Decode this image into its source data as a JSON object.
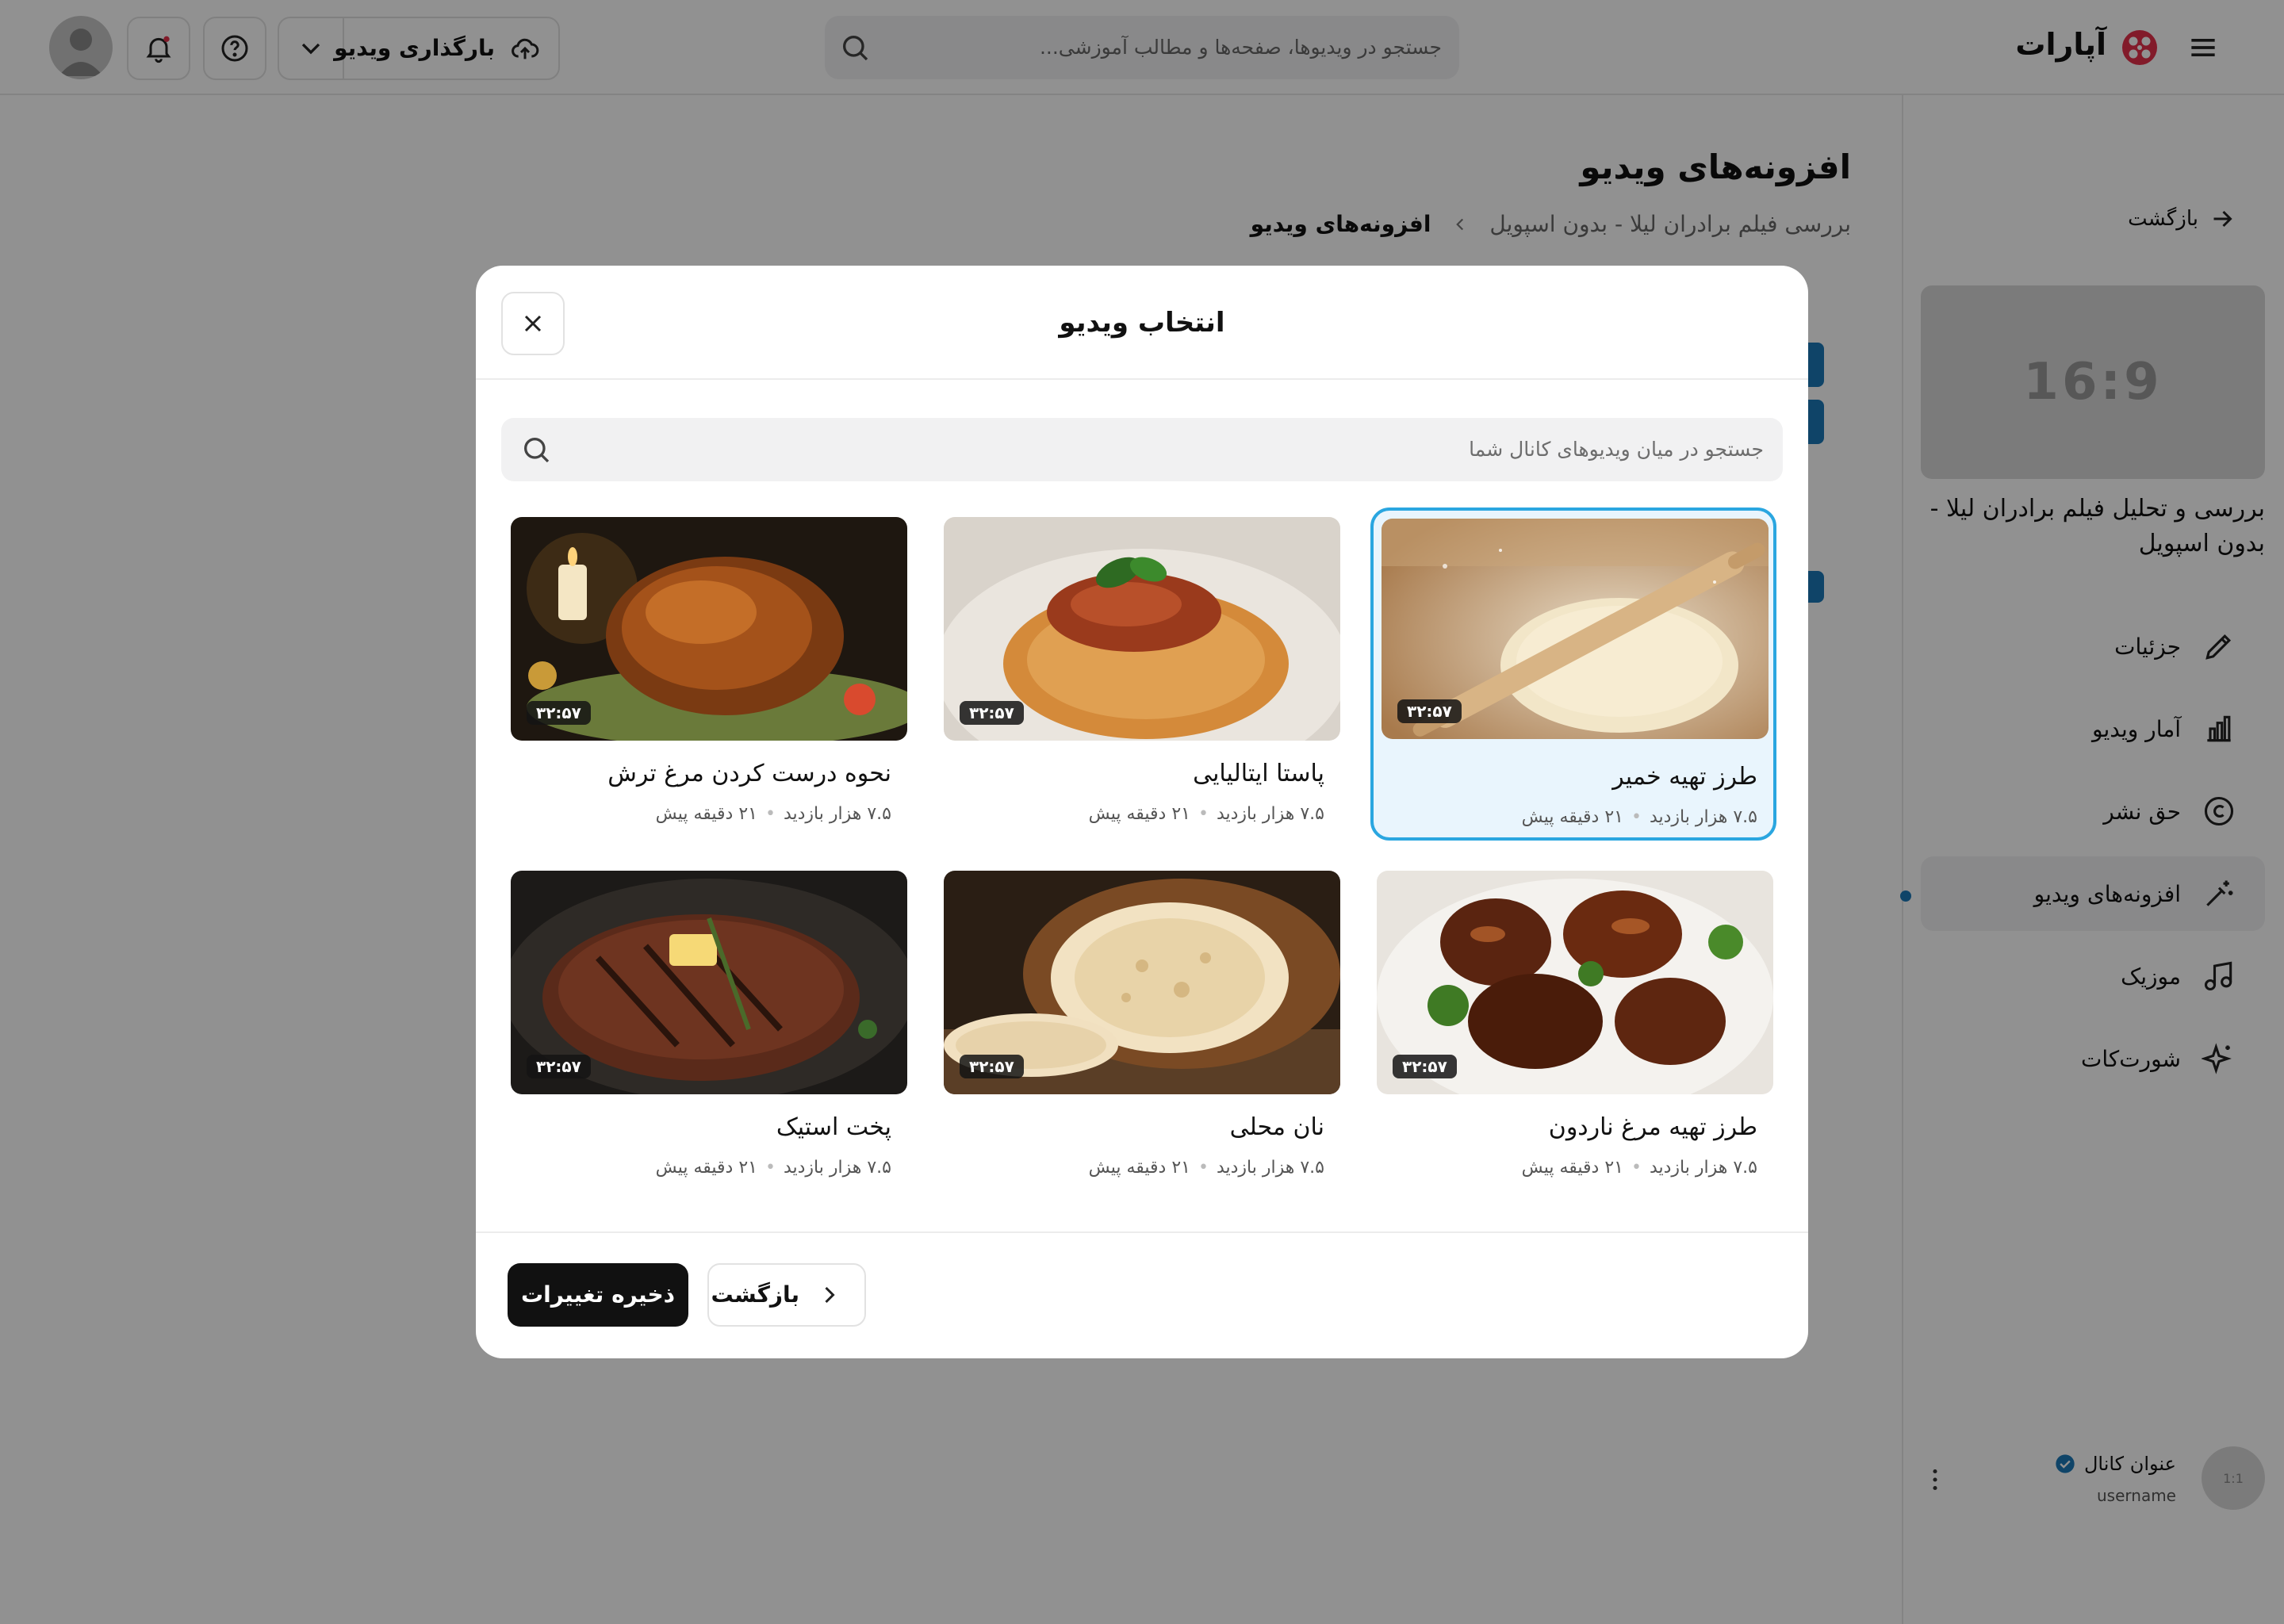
{
  "header": {
    "logo_text": "آپارات",
    "search_placeholder": "جستجو در ویدیوها، صفحه‌ها و مطالب آموزشی...",
    "upload_label": "بارگذاری ویدیو"
  },
  "sidebar": {
    "back_label": "بازگشت",
    "preview_ratio": "16:9",
    "video_title": "بررسی و تحلیل فیلم برادران لیلا - بدون اسپویل",
    "items": [
      {
        "label": "جزئیات",
        "icon": "pencil-icon"
      },
      {
        "label": "آمار ویدیو",
        "icon": "chart-icon"
      },
      {
        "label": "حق نشر",
        "icon": "copyright-icon"
      },
      {
        "label": "افزونه‌های ویدیو",
        "icon": "magic-wand-icon",
        "active": true
      },
      {
        "label": "موزیک",
        "icon": "music-icon"
      },
      {
        "label": "شورت‌کات",
        "icon": "sparkles-icon"
      }
    ],
    "channel": {
      "title": "عنوان کانال",
      "username": "username",
      "avatar_text": "1:1"
    }
  },
  "main": {
    "page_title": "افزونه‌های ویدیو",
    "breadcrumb": [
      "بررسی فیلم برادران لیلا - بدون اسپویل",
      "افزونه‌های ویدیو"
    ]
  },
  "modal": {
    "title": "انتخاب ویدیو",
    "search_placeholder": "جستجو در میان ویدیوهای کانال شما",
    "save_label": "ذخیره تغییرات",
    "back_label": "بازگشت",
    "videos": [
      {
        "title": "طرز تهیه خمیر",
        "views": "۷.۵ هزار بازدید",
        "time": "۲۱ دقیقه پیش",
        "duration": "۳۲:۵۷",
        "selected": true
      },
      {
        "title": "پاستا ایتالیایی",
        "views": "۷.۵ هزار بازدید",
        "time": "۲۱ دقیقه پیش",
        "duration": "۳۲:۵۷"
      },
      {
        "title": "نحوه درست کردن مرغ ترش",
        "views": "۷.۵ هزار بازدید",
        "time": "۲۱ دقیقه پیش",
        "duration": "۳۲:۵۷"
      },
      {
        "title": "طرز تهیه مرغ ناردون",
        "views": "۷.۵ هزار بازدید",
        "time": "۲۱ دقیقه پیش",
        "duration": "۳۲:۵۷"
      },
      {
        "title": "نان محلی",
        "views": "۷.۵ هزار بازدید",
        "time": "۲۱ دقیقه پیش",
        "duration": "۳۲:۵۷"
      },
      {
        "title": "پخت استیک",
        "views": "۷.۵ هزار بازدید",
        "time": "۲۱ دقیقه پیش",
        "duration": "۳۲:۵۷"
      }
    ]
  },
  "colors": {
    "accent": "#2aa6e0",
    "brand": "#e4314b",
    "dark": "#111111"
  }
}
